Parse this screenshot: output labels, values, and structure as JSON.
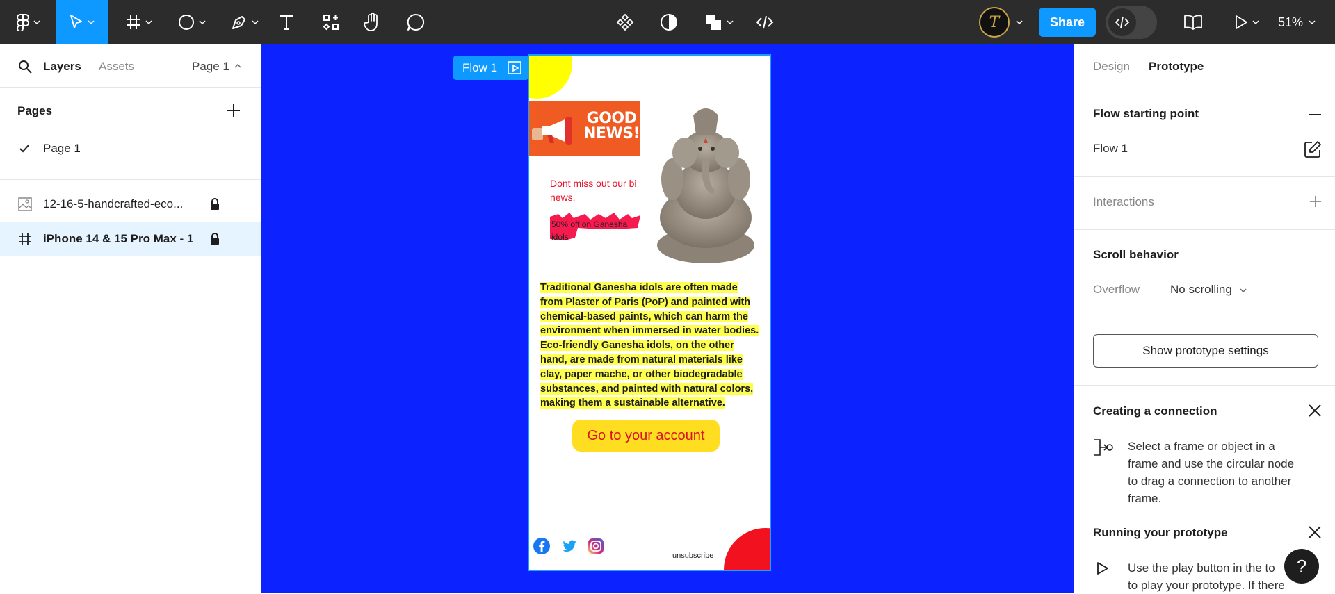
{
  "toolbar": {
    "zoom": "51%",
    "share_label": "Share",
    "avatar_initial": "T"
  },
  "left_panel": {
    "tabs": {
      "layers": "Layers",
      "assets": "Assets",
      "page_selector": "Page 1"
    },
    "pages_heading": "Pages",
    "pages": [
      {
        "label": "Page 1",
        "selected": true
      }
    ],
    "layers": [
      {
        "label": "12-16-5-handcrafted-eco...",
        "type": "image",
        "locked": true
      },
      {
        "label": "iPhone 14 & 15 Pro Max - 1",
        "type": "frame",
        "locked": true,
        "selected": true
      }
    ]
  },
  "canvas": {
    "background": "#0c23ff",
    "flow_tag": "Flow 1",
    "frame": {
      "good_news": [
        "GOOD",
        "NEWS!"
      ],
      "dont_miss_lines": [
        "Dont miss out our bi",
        "news."
      ],
      "sale_lines": [
        "50% off on Ganesha",
        "idols"
      ],
      "body_lines": [
        "Traditional Ganesha idols are often made",
        "from Plaster of Paris (PoP) and painted with",
        "chemical-based paints, which can harm the",
        "environment when immersed in water bodies.",
        "Eco-friendly Ganesha idols, on the other",
        "hand, are made from natural materials like",
        "clay, paper mache, or other biodegradable",
        "substances, and painted with natural colors,",
        "making them a sustainable alternative."
      ],
      "cta_label": "Go to your account",
      "unsubscribe": "unsubscribe"
    }
  },
  "right_panel": {
    "tabs": {
      "design": "Design",
      "prototype": "Prototype"
    },
    "flow_starting_point": "Flow starting point",
    "flow_name": "Flow 1",
    "interactions": "Interactions",
    "scroll_behavior": "Scroll behavior",
    "overflow_label": "Overflow",
    "overflow_value": "No scrolling",
    "show_settings_button": "Show prototype settings",
    "creating_connection_title": "Creating a connection",
    "creating_connection_lines": [
      "Select a frame or object in a",
      "frame and use the circular node",
      "to drag a connection to another",
      "frame."
    ],
    "running_prototype_title": "Running your prototype",
    "running_prototype_lines": [
      "Use the play button in the to",
      "to play your prototype. If there"
    ],
    "help_label": "?"
  }
}
